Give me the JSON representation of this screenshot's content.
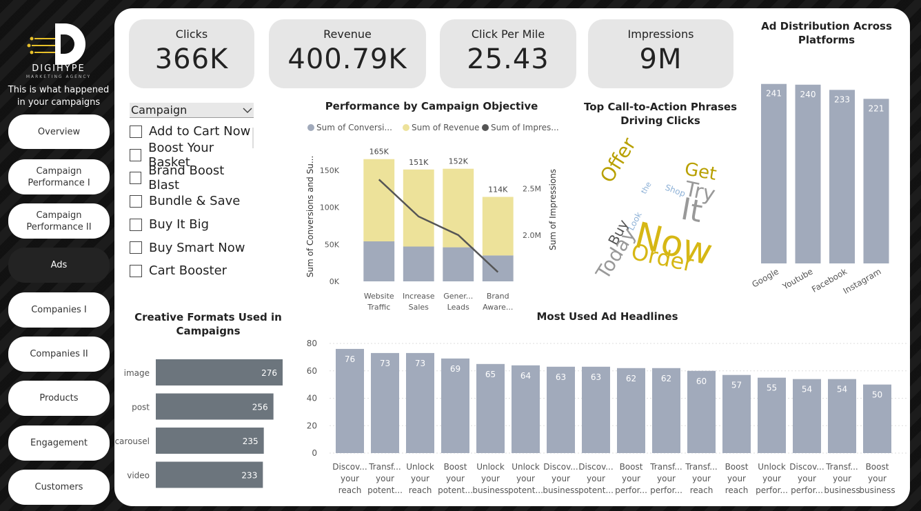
{
  "brand": {
    "name": "DIGIHYPE",
    "subtitle": "MARKETING AGENCY",
    "tagline": "This is what happened in your campaigns",
    "accent": "#e8c12a"
  },
  "nav": [
    {
      "label": "Overview",
      "active": false
    },
    {
      "label": "Campaign Performance I",
      "active": false
    },
    {
      "label": "Campaign Performance II",
      "active": false
    },
    {
      "label": "Ads",
      "active": true
    },
    {
      "label": "Companies I",
      "active": false
    },
    {
      "label": "Companies II",
      "active": false
    },
    {
      "label": "Products",
      "active": false
    },
    {
      "label": "Engagement",
      "active": false
    },
    {
      "label": "Customers",
      "active": false
    }
  ],
  "kpis": [
    {
      "label": "Clicks",
      "value": "366K"
    },
    {
      "label": "Revenue",
      "value": "400.79K"
    },
    {
      "label": "Click Per Mile",
      "value": "25.43"
    },
    {
      "label": "Impressions",
      "value": "9M"
    }
  ],
  "slicer": {
    "title": "Campaign",
    "items": [
      "Add to Cart Now",
      "Boost Your Basket",
      "Brand Boost Blast",
      "Bundle & Save",
      "Buy It Big",
      "Buy Smart Now",
      "Cart Booster"
    ]
  },
  "wordcloud": {
    "title": "Top Call-to-Action Phrases Driving Clicks",
    "words": [
      "Offer",
      "Get",
      "Try",
      "It",
      "the",
      "Shop",
      "Look",
      "Buy",
      "Now",
      "Today",
      "Order"
    ]
  },
  "chart_data": [
    {
      "type": "bar",
      "title": "Performance by Campaign Objective",
      "categories": [
        "Website Traffic",
        "Increase Sales",
        "Gener... Leads",
        "Brand Aware..."
      ],
      "series": [
        {
          "name": "Sum of Conversi...",
          "values": [
            54000,
            47000,
            46000,
            35000
          ],
          "color": "#a1aabb"
        },
        {
          "name": "Sum of Revenue",
          "values": [
            111000,
            104000,
            106000,
            79000
          ],
          "color": "#ede29a"
        },
        {
          "name": "Sum of Impres...",
          "values": [
            2600000.0,
            2200000.0,
            2000000.0,
            1600000.0
          ],
          "color": "#555555"
        }
      ],
      "data_labels": [
        "165K",
        "151K",
        "152K",
        "114K"
      ],
      "ylabel": "Sum of Conversions and Su...",
      "y2label": "Sum of Impressions",
      "y_ticks": [
        "0K",
        "50K",
        "100K",
        "150K"
      ],
      "y2_ticks": [
        "2.0M",
        "2.5M"
      ],
      "ylim": [
        0,
        175000
      ],
      "y2lim": [
        1500000.0,
        2900000.0
      ]
    },
    {
      "type": "bar",
      "title": "Ad Distribution Across Platforms",
      "categories": [
        "Google",
        "Youtube",
        "Facebook",
        "Instagram"
      ],
      "values": [
        241,
        240,
        233,
        221
      ],
      "color": "#a1aabb"
    },
    {
      "type": "bar",
      "orientation": "horizontal",
      "title": "Creative Formats Used in Campaigns",
      "categories": [
        "image",
        "post",
        "carousel",
        "video"
      ],
      "values": [
        276,
        256,
        235,
        233
      ],
      "color": "#6c757d"
    },
    {
      "type": "bar",
      "title": "Most Used Ad Headlines",
      "categories": [
        [
          "Discov...",
          "your",
          "reach"
        ],
        [
          "Transf...",
          "your",
          "potent..."
        ],
        [
          "Unlock",
          "your",
          "reach"
        ],
        [
          "Boost",
          "your",
          "potent..."
        ],
        [
          "Unlock",
          "your",
          "business"
        ],
        [
          "Unlock",
          "your",
          "potent..."
        ],
        [
          "Discov...",
          "your",
          "business"
        ],
        [
          "Discov...",
          "your",
          "potent..."
        ],
        [
          "Boost",
          "your",
          "perfor..."
        ],
        [
          "Transf...",
          "your",
          "perfor..."
        ],
        [
          "Transf...",
          "your",
          "reach"
        ],
        [
          "Boost",
          "your",
          "reach"
        ],
        [
          "Unlock",
          "your",
          "perfor..."
        ],
        [
          "Discov...",
          "your",
          "perfor..."
        ],
        [
          "Transf...",
          "your",
          "business"
        ],
        [
          "Boost",
          "your",
          "business"
        ]
      ],
      "values": [
        76,
        73,
        73,
        69,
        65,
        64,
        63,
        63,
        62,
        62,
        60,
        57,
        55,
        54,
        54,
        50
      ],
      "y_ticks": [
        "0",
        "20",
        "40",
        "60",
        "80"
      ],
      "ylim": [
        0,
        80
      ],
      "color": "#a1aabb"
    }
  ]
}
